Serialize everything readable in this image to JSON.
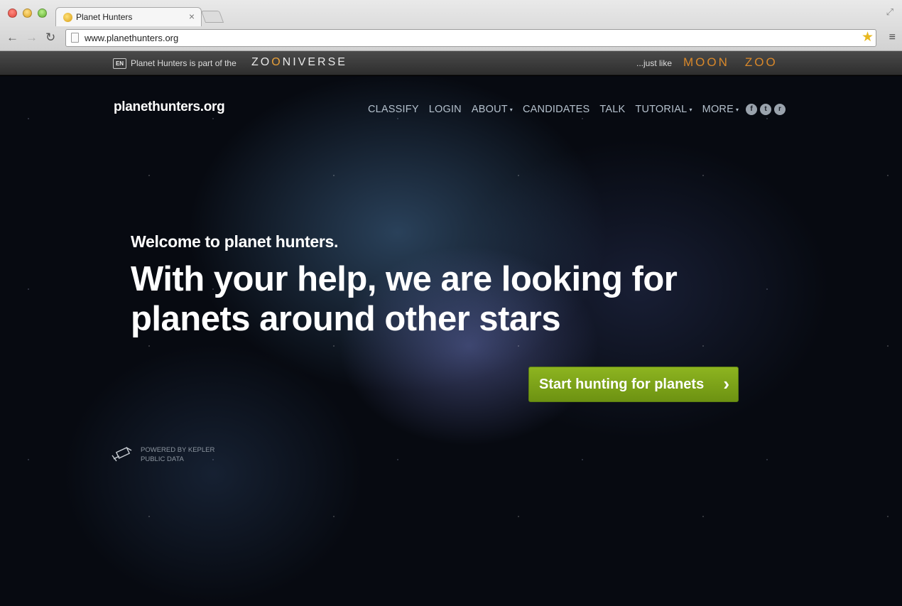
{
  "browser": {
    "tab_title": "Planet Hunters",
    "tab_close": "×",
    "url": "www.planethunters.org",
    "back_icon": "←",
    "forward_icon": "→",
    "reload_icon": "C",
    "star_icon": "★",
    "menu_icon": "≡",
    "fullscreen_icon": "⤢"
  },
  "zbar": {
    "lang": "EN",
    "text": "Planet Hunters is part of the",
    "zooniverse_a": "ZO",
    "zooniverse_o": "O",
    "zooniverse_b": "NIVERSE",
    "just_like": "...just like",
    "moon": "MOON",
    "zoo": "ZOO"
  },
  "site": {
    "logo": "planethunters.org",
    "nav": [
      {
        "label": "CLASSIFY",
        "caret": false
      },
      {
        "label": "LOGIN",
        "caret": false
      },
      {
        "label": "ABOUT",
        "caret": true
      },
      {
        "label": "CANDIDATES",
        "caret": false
      },
      {
        "label": "TALK",
        "caret": false
      },
      {
        "label": "TUTORIAL",
        "caret": true
      },
      {
        "label": "MORE",
        "caret": true
      }
    ],
    "caret": "▾",
    "social": [
      "f",
      "t",
      "r"
    ]
  },
  "hero": {
    "welcome": "Welcome to planet hunters.",
    "headline": "With your help, we are looking for planets around other stars",
    "cta_label": "Start hunting for planets",
    "cta_chevron": "›"
  },
  "kepler": {
    "line1": "POWERED BY KEPLER",
    "line2": "PUBLIC DATA"
  }
}
